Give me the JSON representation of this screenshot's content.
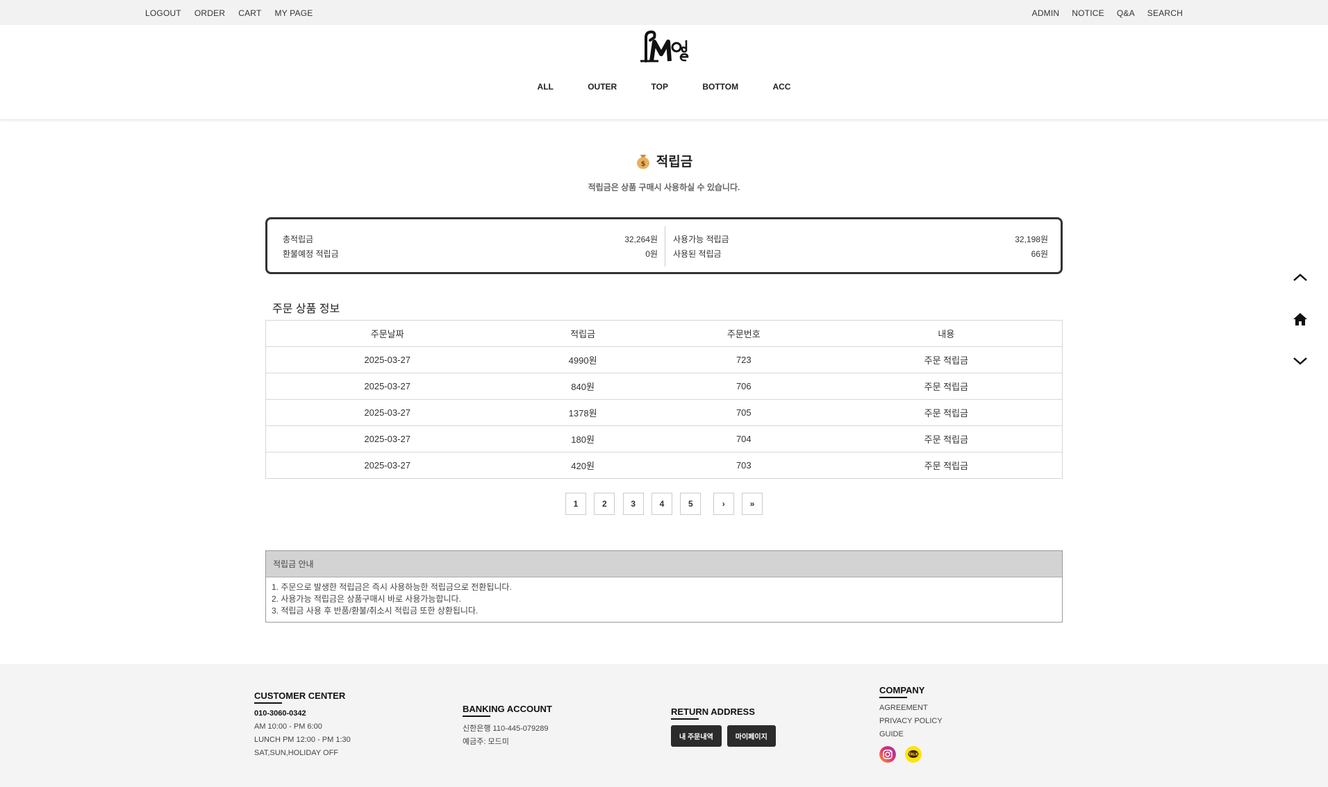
{
  "topbar": {
    "left": [
      "LOGOUT",
      "ORDER",
      "CART",
      "MY PAGE"
    ],
    "right": [
      "ADMIN",
      "NOTICE",
      "Q&A",
      "SEARCH"
    ]
  },
  "brand": {
    "logo_text": "Mode"
  },
  "gnb": [
    "ALL",
    "OUTER",
    "TOP",
    "BOTTOM",
    "ACC"
  ],
  "page": {
    "title": "적립금",
    "subtitle": "적립금은 상품 구매시 사용하실 수 있습니다."
  },
  "summary": {
    "total_label": "총적립금",
    "total_value": "32,264원",
    "refund_label": "환불예정 적립금",
    "refund_value": "0원",
    "available_label": "사용가능 적립금",
    "available_value": "32,198원",
    "used_label": "사용된 적립금",
    "used_value": "66원"
  },
  "section_title": "주문 상품 정보",
  "table": {
    "headers": [
      "주문날짜",
      "적립금",
      "주문번호",
      "내용"
    ],
    "rows": [
      [
        "2025-03-27",
        "4990원",
        "723",
        "주문 적립금"
      ],
      [
        "2025-03-27",
        "840원",
        "706",
        "주문 적립금"
      ],
      [
        "2025-03-27",
        "1378원",
        "705",
        "주문 적립금"
      ],
      [
        "2025-03-27",
        "180원",
        "704",
        "주문 적립금"
      ],
      [
        "2025-03-27",
        "420원",
        "703",
        "주문 적립금"
      ]
    ]
  },
  "pager": [
    "1",
    "2",
    "3",
    "4",
    "5",
    "›",
    "»"
  ],
  "info": {
    "title": "적립금 안내",
    "lines": [
      "1. 주문으로 발생한 적립금은 즉시 사용하능한 적립금으로 전환됩니다.",
      "2. 사용가능 적립금은 상품구매시 바로 사용가능합니다.",
      "3. 적립금 사용 후 반품/환불/취소시 적립금 또한 상환됩니다."
    ]
  },
  "quick_icons": [
    "chevron-up-icon",
    "home-icon",
    "chevron-down-icon"
  ],
  "footer": {
    "customer": {
      "title": "CUSTOMER CENTER",
      "phone": "010-3060-0342",
      "hours": "AM 10:00 - PM 6:00",
      "lunch": "LUNCH PM 12:00 - PM 1:30",
      "off": "SAT,SUN,HOLIDAY OFF"
    },
    "banking": {
      "title": "BANKING ACCOUNT",
      "account": "신한은행 110-445-079289",
      "holder": "예금주: 모드미"
    },
    "return": {
      "title": "RETURN ADDRESS",
      "btn_orders": "내 주문내역",
      "btn_mypage": "마이페이지"
    },
    "company": {
      "title": "COMPANY",
      "links": [
        "AGREEMENT",
        "PRIVACY POLICY",
        "GUIDE"
      ],
      "kakao_text": "TALK"
    }
  },
  "colors": {
    "accent": "#333333",
    "info_head": "#d3d3d3",
    "footer_bg": "#f4f4f4"
  }
}
